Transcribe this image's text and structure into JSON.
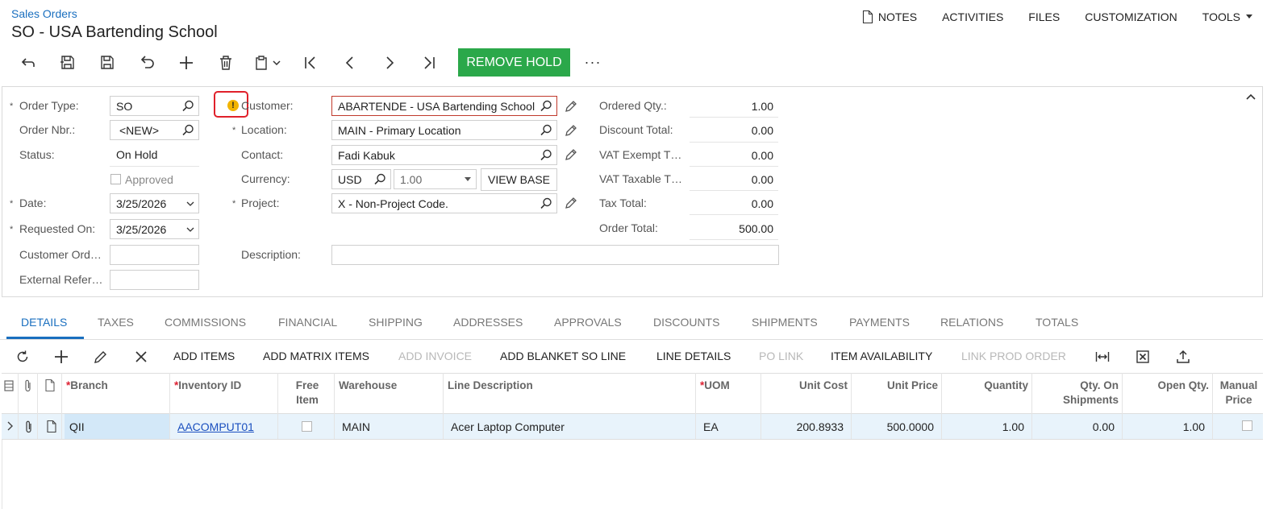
{
  "header": {
    "breadcrumb": "Sales Orders",
    "title": "SO - USA Bartending School"
  },
  "top_menu": {
    "notes": "NOTES",
    "activities": "ACTIVITIES",
    "files": "FILES",
    "customization": "CUSTOMIZATION",
    "tools": "TOOLS"
  },
  "toolbar": {
    "remove_hold": "REMOVE HOLD",
    "more": "···"
  },
  "form": {
    "order_type": {
      "label": "Order Type:",
      "value": "SO"
    },
    "order_nbr": {
      "label": "Order Nbr.:",
      "value": "<NEW>"
    },
    "status": {
      "label": "Status:",
      "value": "On Hold"
    },
    "approved": {
      "label": "Approved"
    },
    "date": {
      "label": "Date:",
      "value": "3/25/2026"
    },
    "requested_on": {
      "label": "Requested On:",
      "value": "3/25/2026"
    },
    "customer_ord": {
      "label": "Customer Ord…",
      "value": ""
    },
    "external_ref": {
      "label": "External Refer…",
      "value": ""
    },
    "customer": {
      "label": "Customer:",
      "value": "ABARTENDE - USA Bartending School"
    },
    "location": {
      "label": "Location:",
      "value": "MAIN - Primary Location"
    },
    "contact": {
      "label": "Contact:",
      "value": "Fadi Kabuk"
    },
    "currency": {
      "label": "Currency:",
      "value": "USD",
      "rate": "1.00",
      "view_base": "VIEW BASE"
    },
    "project": {
      "label": "Project:",
      "value": "X - Non-Project Code."
    },
    "description": {
      "label": "Description:",
      "value": ""
    },
    "ordered_qty": {
      "label": "Ordered Qty.:",
      "value": "1.00"
    },
    "discount_total": {
      "label": "Discount Total:",
      "value": "0.00"
    },
    "vat_exempt": {
      "label": "VAT Exempt T…",
      "value": "0.00"
    },
    "vat_taxable": {
      "label": "VAT Taxable T…",
      "value": "0.00"
    },
    "tax_total": {
      "label": "Tax Total:",
      "value": "0.00"
    },
    "order_total": {
      "label": "Order Total:",
      "value": "500.00"
    }
  },
  "tabs": [
    "DETAILS",
    "TAXES",
    "COMMISSIONS",
    "FINANCIAL",
    "SHIPPING",
    "ADDRESSES",
    "APPROVALS",
    "DISCOUNTS",
    "SHIPMENTS",
    "PAYMENTS",
    "RELATIONS",
    "TOTALS"
  ],
  "grid_toolbar": {
    "add_items": "ADD ITEMS",
    "add_matrix_items": "ADD MATRIX ITEMS",
    "add_invoice": "ADD INVOICE",
    "add_blanket": "ADD BLANKET SO LINE",
    "line_details": "LINE DETAILS",
    "po_link": "PO LINK",
    "item_availability": "ITEM AVAILABILITY",
    "link_prod_order": "LINK PROD ORDER"
  },
  "grid": {
    "columns": {
      "branch": "Branch",
      "inventory_id": "Inventory ID",
      "free_item_1": "Free",
      "free_item_2": "Item",
      "warehouse": "Warehouse",
      "line_description": "Line Description",
      "uom": "UOM",
      "unit_cost": "Unit Cost",
      "unit_price": "Unit Price",
      "quantity": "Quantity",
      "qty_on_ship_1": "Qty. On",
      "qty_on_ship_2": "Shipments",
      "open_qty": "Open Qty.",
      "manual_price_1": "Manual",
      "manual_price_2": "Price"
    },
    "rows": [
      {
        "branch": "QII",
        "inventory_id": "AACOMPUT01",
        "warehouse": "MAIN",
        "line_description": "Acer Laptop Computer",
        "uom": "EA",
        "unit_cost": "200.8933",
        "unit_price": "500.0000",
        "quantity": "1.00",
        "qty_on_shipments": "0.00",
        "open_qty": "1.00"
      }
    ]
  }
}
